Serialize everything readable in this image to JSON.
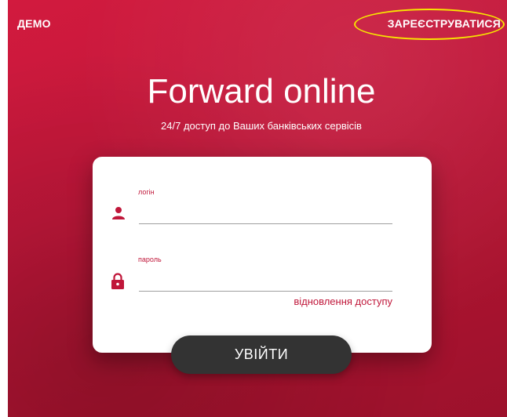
{
  "header": {
    "demo_label": "ДЕМО",
    "register_label": "ЗАРЕЄСТРУВАТИСЯ"
  },
  "hero": {
    "title": "Forward online",
    "subtitle": "24/7 доступ до Ваших банківських сервісів"
  },
  "form": {
    "login_label": "логін",
    "login_value": "",
    "password_label": "пароль",
    "password_value": "",
    "restore_link": "відновлення доступу",
    "submit_label": "УВІЙТИ",
    "user_icon": "user-icon",
    "lock_icon": "lock-icon"
  },
  "colors": {
    "background": "#c1173a",
    "accent": "#c0173a",
    "button": "#333333",
    "highlight": "#f7e600"
  }
}
